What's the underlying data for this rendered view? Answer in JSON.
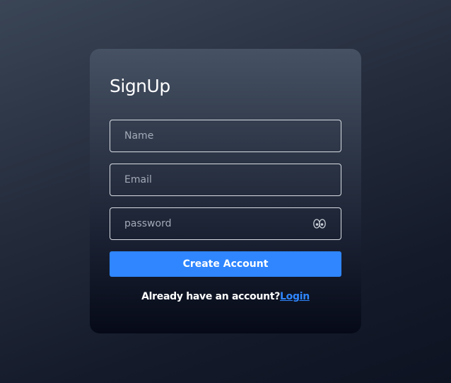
{
  "form": {
    "title": "SignUp",
    "name_placeholder": "Name",
    "email_placeholder": "Email",
    "password_placeholder": "password",
    "password_toggle_icon": "eye-icon",
    "submit_label": "Create Account",
    "footer_text": "Already have an account?",
    "login_link_label": "Login"
  },
  "colors": {
    "accent": "#2f86ff",
    "card_top": "#465264",
    "card_bottom": "#060a18",
    "input_border": "#d9dde4"
  }
}
